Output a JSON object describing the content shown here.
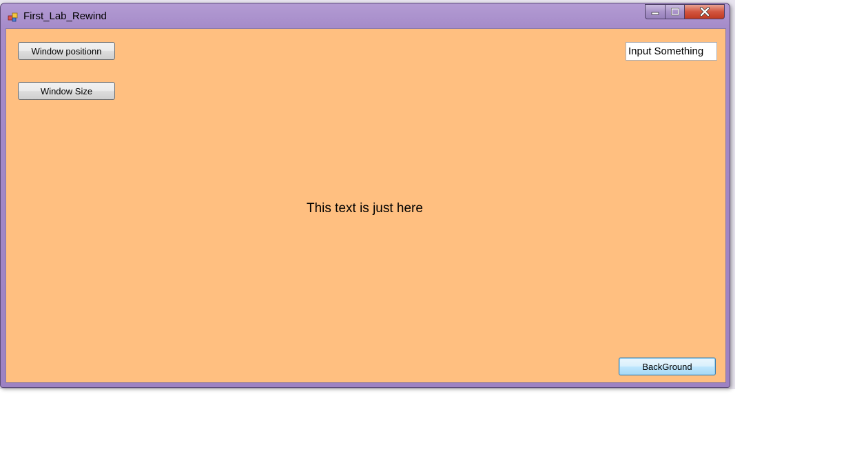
{
  "window": {
    "title": "First_Lab_Rewind"
  },
  "buttons": {
    "window_position": "Window positionn",
    "window_size": "Window Size",
    "background": "BackGround"
  },
  "input": {
    "value": "Input Something"
  },
  "center_label": "This text is just here",
  "colors": {
    "client_background": "#ffbf80",
    "title_bar": "#a58bc9",
    "close_button": "#d2553f"
  },
  "icons": {
    "app": "app-icon",
    "minimize": "minimize-icon",
    "maximize": "maximize-icon",
    "close": "close-icon"
  }
}
